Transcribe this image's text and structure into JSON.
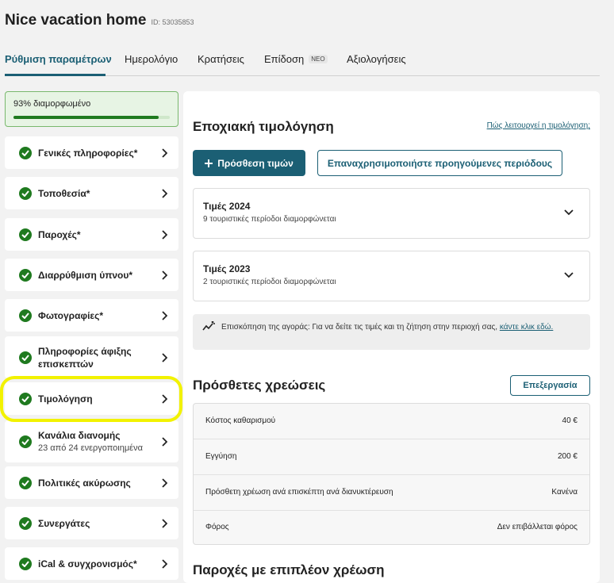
{
  "header": {
    "title": "Nice vacation home",
    "listing_id": "ID: 53035853"
  },
  "tabs": [
    {
      "label": "Ρύθμιση παραμέτρων"
    },
    {
      "label": "Ημερολόγιο"
    },
    {
      "label": "Κρατήσεις"
    },
    {
      "label": "Επίδοση",
      "badge": "ΝΕΟ"
    },
    {
      "label": "Αξιολογήσεις"
    }
  ],
  "progress": {
    "label": "93% διαμορφωμένο",
    "value": 0.93
  },
  "sidebar": {
    "items": [
      {
        "label": "Γενικές πληροφορίες*"
      },
      {
        "label": "Τοποθεσία*"
      },
      {
        "label": "Παροχές*"
      },
      {
        "label": "Διαρρύθμιση ύπνου*"
      },
      {
        "label": "Φωτογραφίες*"
      },
      {
        "label": "Πληροφορίες άφιξης επισκεπτών"
      },
      {
        "label": "Τιμολόγηση"
      },
      {
        "label": "Κανάλια διανομής",
        "sublabel": "23 από 24 ενεργοποιημένα"
      },
      {
        "label": "Πολιτικές ακύρωσης"
      },
      {
        "label": "Συνεργάτες"
      },
      {
        "label": "iCal & συγχρονισμός*"
      }
    ]
  },
  "seasonal": {
    "title": "Εποχιακή τιμολόγηση",
    "help_link": "Πώς λειτουργεί η τιμολόγηση;",
    "add_button": "Πρόσθεση τιμών",
    "reuse_button": "Επαναχρησιμοποιήστε προηγούμενες περιόδους",
    "years": [
      {
        "title": "Τιμές 2024",
        "subtitle": "9 τουριστικές περίοδοι διαμορφώνεται"
      },
      {
        "title": "Τιμές 2023",
        "subtitle": "2 τουριστικές περίοδοι διαμορφώνεται"
      }
    ],
    "insight_text": "Επισκόπηση της αγοράς: Για να δείτε τις τιμές και τη ζήτηση στην περιοχή σας,",
    "insight_link": "κάντε κλικ εδώ."
  },
  "extra_fees": {
    "title": "Πρόσθετες χρεώσεις",
    "edit_button": "Επεξεργασία",
    "rows": [
      {
        "label": "Κόστος καθαρισμού",
        "value": "40 €"
      },
      {
        "label": "Εγγύηση",
        "value": "200 €"
      },
      {
        "label": "Πρόσθετη χρέωση ανά επισκέπτη ανά διανυκτέρευση",
        "value": "Κανένα"
      },
      {
        "label": "Φόρος",
        "value": "Δεν επιβάλλεται φόρος"
      }
    ]
  },
  "paid_amenities": {
    "title": "Παροχές με επιπλέον χρέωση"
  },
  "colors": {
    "accent": "#1b5f74",
    "success": "#1f7a1f",
    "highlight": "#f2f200"
  }
}
